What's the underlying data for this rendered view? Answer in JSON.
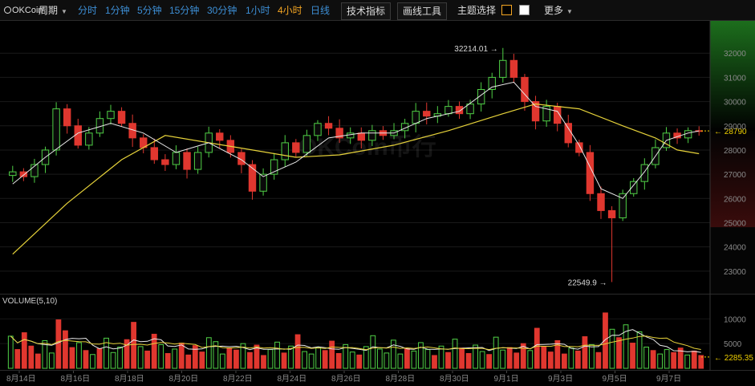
{
  "toolbar": {
    "brand": "OKCoin",
    "period_label": "周期",
    "intervals": [
      {
        "label": "分时",
        "active": false
      },
      {
        "label": "1分钟",
        "active": false
      },
      {
        "label": "5分钟",
        "active": false
      },
      {
        "label": "15分钟",
        "active": false
      },
      {
        "label": "30分钟",
        "active": false
      },
      {
        "label": "1小时",
        "active": false
      },
      {
        "label": "4小时",
        "active": true
      },
      {
        "label": "日线",
        "active": false
      }
    ],
    "tech_indicator_label": "技术指标",
    "drawing_tools_label": "画线工具",
    "theme_label": "主题选择",
    "more_label": "更多"
  },
  "watermark": "OKCoin币行",
  "colors": {
    "up": "#4fcf45",
    "down": "#e0372f",
    "ma_fast": "#e8e8e8",
    "ma_slow": "#e6d23a",
    "background": "#000000",
    "accent": "#f5a623"
  },
  "chart_data": [
    {
      "type": "candlestick",
      "title": "",
      "x_ticks": [
        "8月14日",
        "8月16日",
        "8月18日",
        "8月20日",
        "8月22日",
        "8月24日",
        "8月26日",
        "8月28日",
        "8月30日",
        "9月1日",
        "9月3日",
        "9月5日",
        "9月7日"
      ],
      "y_ticks": [
        23000,
        24000,
        25000,
        26000,
        27000,
        28000,
        29000,
        30000,
        31000,
        32000
      ],
      "ylim": [
        22200,
        33200
      ],
      "grid": true,
      "annotations": {
        "high": {
          "label": "32214.01",
          "value": 32214.01
        },
        "low": {
          "label": "22549.9",
          "value": 22549.9
        },
        "last": {
          "label": "28790",
          "value": 28790
        }
      },
      "close_path": [
        [
          0,
          27100
        ],
        [
          1,
          26900
        ],
        [
          2,
          27400
        ],
        [
          3,
          28000
        ],
        [
          4,
          29700
        ],
        [
          5,
          29000
        ],
        [
          6,
          28200
        ],
        [
          7,
          28700
        ],
        [
          8,
          29300
        ],
        [
          9,
          29600
        ],
        [
          10,
          29100
        ],
        [
          11,
          28500
        ],
        [
          12,
          28100
        ],
        [
          13,
          27600
        ],
        [
          14,
          27400
        ],
        [
          15,
          27900
        ],
        [
          16,
          27200
        ],
        [
          17,
          27900
        ],
        [
          18,
          28700
        ],
        [
          19,
          28400
        ],
        [
          20,
          27900
        ],
        [
          21,
          27400
        ],
        [
          22,
          26300
        ],
        [
          23,
          27000
        ],
        [
          24,
          27600
        ],
        [
          25,
          28300
        ],
        [
          26,
          27900
        ],
        [
          27,
          28600
        ],
        [
          28,
          29100
        ],
        [
          29,
          28900
        ],
        [
          30,
          28500
        ],
        [
          31,
          28700
        ],
        [
          32,
          28400
        ],
        [
          33,
          28800
        ],
        [
          34,
          28600
        ],
        [
          35,
          28800
        ],
        [
          36,
          29100
        ],
        [
          37,
          29600
        ],
        [
          38,
          29400
        ],
        [
          39,
          29500
        ],
        [
          40,
          29800
        ],
        [
          41,
          29500
        ],
        [
          42,
          29900
        ],
        [
          43,
          30500
        ],
        [
          44,
          31000
        ],
        [
          45,
          31700
        ],
        [
          46,
          31000
        ],
        [
          47,
          30000
        ],
        [
          48,
          29200
        ],
        [
          49,
          29800
        ],
        [
          50,
          29100
        ],
        [
          51,
          28300
        ],
        [
          52,
          27900
        ],
        [
          53,
          26200
        ],
        [
          54,
          25500
        ],
        [
          55,
          25200
        ],
        [
          56,
          26200
        ],
        [
          57,
          26700
        ],
        [
          58,
          27400
        ],
        [
          59,
          28100
        ],
        [
          60,
          28700
        ],
        [
          61,
          28500
        ],
        [
          62,
          28800
        ],
        [
          63,
          28790
        ]
      ],
      "ma_fast_path": [
        [
          0,
          26600
        ],
        [
          3,
          27700
        ],
        [
          6,
          28700
        ],
        [
          9,
          29100
        ],
        [
          12,
          28700
        ],
        [
          15,
          27900
        ],
        [
          18,
          28300
        ],
        [
          21,
          27600
        ],
        [
          23,
          26900
        ],
        [
          26,
          27500
        ],
        [
          29,
          28500
        ],
        [
          32,
          28700
        ],
        [
          35,
          28700
        ],
        [
          38,
          29300
        ],
        [
          41,
          29600
        ],
        [
          44,
          30600
        ],
        [
          46,
          30800
        ],
        [
          48,
          29800
        ],
        [
          50,
          29600
        ],
        [
          52,
          28200
        ],
        [
          54,
          26400
        ],
        [
          56,
          26000
        ],
        [
          58,
          27100
        ],
        [
          60,
          28400
        ],
        [
          62,
          28700
        ],
        [
          63,
          28790
        ]
      ],
      "ma_slow_path": [
        [
          0,
          23700
        ],
        [
          5,
          25800
        ],
        [
          10,
          27600
        ],
        [
          14,
          28600
        ],
        [
          18,
          28300
        ],
        [
          22,
          28000
        ],
        [
          26,
          27700
        ],
        [
          30,
          27800
        ],
        [
          35,
          28200
        ],
        [
          40,
          28800
        ],
        [
          45,
          29500
        ],
        [
          48,
          29900
        ],
        [
          52,
          29700
        ],
        [
          56,
          29000
        ],
        [
          59,
          28500
        ],
        [
          61,
          28000
        ],
        [
          63,
          27850
        ]
      ]
    },
    {
      "type": "bar",
      "title": "VOLUME(5,10)",
      "y_ticks": [
        5000,
        10000
      ],
      "ylim": [
        0,
        12000
      ],
      "last": {
        "label": "2285.35",
        "value": 2285.35
      },
      "values": [
        6500,
        3800,
        7200,
        4500,
        2900,
        5600,
        3100,
        9800,
        7600,
        4200,
        5200,
        3600,
        2800,
        4000,
        6100,
        3200,
        4300,
        5800,
        9300,
        4400,
        3500,
        6900,
        4800,
        3000,
        3900,
        5100,
        2700,
        4600,
        3300,
        6200,
        5400,
        2900,
        4100,
        3700,
        5000,
        3200,
        4700,
        2600,
        3800,
        5300,
        3100,
        4500,
        6800,
        3400,
        2900,
        4200,
        3600,
        5500,
        3000,
        4800,
        3300,
        2700,
        4400,
        6600,
        3900,
        3100,
        5700,
        2900,
        4000,
        3500,
        5200,
        3800,
        2600,
        4500,
        3200,
        5900,
        4100,
        3000,
        4700,
        3400,
        2800,
        6300,
        3700,
        4200,
        3100,
        5000,
        3600,
        8100,
        4400,
        3300,
        5600,
        2900,
        4100,
        3500,
        6400,
        4800,
        3200,
        11200,
        7900,
        6200,
        8800,
        5100,
        7400,
        4300,
        3600,
        2900,
        3800,
        3200,
        4100,
        2700,
        3500,
        2600
      ]
    }
  ]
}
